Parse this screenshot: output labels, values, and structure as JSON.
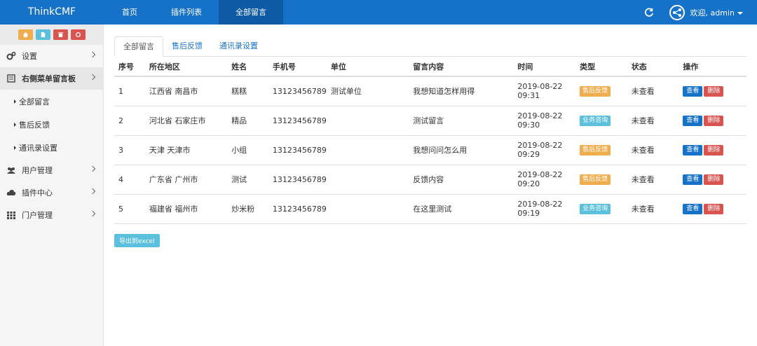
{
  "header": {
    "brand": "ThinkCMF",
    "nav": [
      "首页",
      "插件列表",
      "全部留言"
    ],
    "active_nav": 2,
    "user_label": "欢迎, admin"
  },
  "quick_buttons": [
    {
      "icon": "home-icon",
      "color": "#f0ad4e"
    },
    {
      "icon": "file-icon",
      "color": "#5bc0de"
    },
    {
      "icon": "trash-icon",
      "color": "#d9534f"
    },
    {
      "icon": "recycle-icon",
      "color": "#d9534f"
    }
  ],
  "sidebar": {
    "items": [
      {
        "label": "设置",
        "icon": "gears-icon"
      },
      {
        "label": "右侧菜单留言板",
        "icon": "book-icon"
      },
      {
        "label": "用户管理",
        "icon": "users-icon"
      },
      {
        "label": "插件中心",
        "icon": "cloud-icon"
      },
      {
        "label": "门户管理",
        "icon": "grid-icon"
      }
    ],
    "subitems": [
      "全部留言",
      "售后反馈",
      "通讯录设置"
    ]
  },
  "tabs": [
    "全部留言",
    "售后反馈",
    "通讯录设置"
  ],
  "table": {
    "headers": [
      "序号",
      "所在地区",
      "姓名",
      "手机号",
      "单位",
      "留言内容",
      "时间",
      "类型",
      "状态",
      "操作"
    ],
    "rows": [
      {
        "id": "1",
        "region": "江西省 南昌市",
        "name": "糕糕",
        "phone": "13123456789",
        "unit": "测试单位",
        "content": "我想知道怎样用得",
        "date": "2019-08-22",
        "time": "09:31",
        "type": "售后反馈",
        "type_color": "#f0ad4e",
        "status": "未查看"
      },
      {
        "id": "2",
        "region": "河北省 石家庄市",
        "name": "精品",
        "phone": "13123456789",
        "unit": "",
        "content": "测试留言",
        "date": "2019-08-22",
        "time": "09:30",
        "type": "业务咨询",
        "type_color": "#5bc0de",
        "status": "未查看"
      },
      {
        "id": "3",
        "region": "天津 天津市",
        "name": "小组",
        "phone": "13123456789",
        "unit": "",
        "content": "我想问问怎么用",
        "date": "2019-08-22",
        "time": "09:29",
        "type": "售后反馈",
        "type_color": "#f0ad4e",
        "status": "未查看"
      },
      {
        "id": "4",
        "region": "广东省 广州市",
        "name": "测试",
        "phone": "13123456789",
        "unit": "",
        "content": "反馈内容",
        "date": "2019-08-22",
        "time": "09:20",
        "type": "售后反馈",
        "type_color": "#f0ad4e",
        "status": "未查看"
      },
      {
        "id": "5",
        "region": "福建省 福州市",
        "name": "炒米粉",
        "phone": "13123456789",
        "unit": "",
        "content": "在这里测试",
        "date": "2019-08-22",
        "time": "09:19",
        "type": "业务咨询",
        "type_color": "#5bc0de",
        "status": "未查看"
      }
    ],
    "view_label": "查看",
    "delete_label": "删除"
  },
  "export_label": "导出到excel"
}
